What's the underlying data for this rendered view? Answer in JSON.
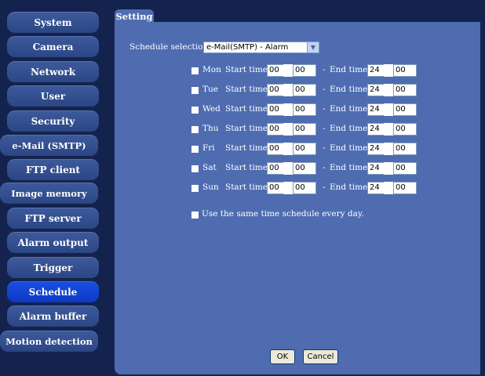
{
  "sidebar": {
    "items": [
      {
        "label": "System",
        "active": false
      },
      {
        "label": "Camera",
        "active": false
      },
      {
        "label": "Network",
        "active": false
      },
      {
        "label": "User",
        "active": false
      },
      {
        "label": "Security",
        "active": false
      },
      {
        "label": "e-Mail (SMTP)",
        "active": false
      },
      {
        "label": "FTP client",
        "active": false
      },
      {
        "label": "Image memory",
        "active": false
      },
      {
        "label": "FTP server",
        "active": false
      },
      {
        "label": "Alarm output",
        "active": false
      },
      {
        "label": "Trigger",
        "active": false
      },
      {
        "label": "Schedule",
        "active": true
      },
      {
        "label": "Alarm buffer",
        "active": false
      },
      {
        "label": "Motion detection",
        "active": false
      }
    ]
  },
  "panel": {
    "tab_label": "Setting",
    "schedule_selection_label": "Schedule selection",
    "schedule_selection_value": "e-Mail(SMTP) - Alarm",
    "start_time_label": "Start time",
    "end_time_label": "End time",
    "dash": "-",
    "days": [
      {
        "day": "Mon",
        "start_h": "00",
        "start_m": "00",
        "end_h": "24",
        "end_m": "00"
      },
      {
        "day": "Tue",
        "start_h": "00",
        "start_m": "00",
        "end_h": "24",
        "end_m": "00"
      },
      {
        "day": "Wed",
        "start_h": "00",
        "start_m": "00",
        "end_h": "24",
        "end_m": "00"
      },
      {
        "day": "Thu",
        "start_h": "00",
        "start_m": "00",
        "end_h": "24",
        "end_m": "00"
      },
      {
        "day": "Fri",
        "start_h": "00",
        "start_m": "00",
        "end_h": "24",
        "end_m": "00"
      },
      {
        "day": "Sat",
        "start_h": "00",
        "start_m": "00",
        "end_h": "24",
        "end_m": "00"
      },
      {
        "day": "Sun",
        "start_h": "00",
        "start_m": "00",
        "end_h": "24",
        "end_m": "00"
      }
    ],
    "same_schedule_label": "Use the same time schedule every day.",
    "ok_label": "OK",
    "cancel_label": "Cancel"
  },
  "colors": {
    "background": "#14234e",
    "panel": "#4f6cb1",
    "nav_button": "#2f4a8a",
    "nav_active": "#1447e0"
  }
}
